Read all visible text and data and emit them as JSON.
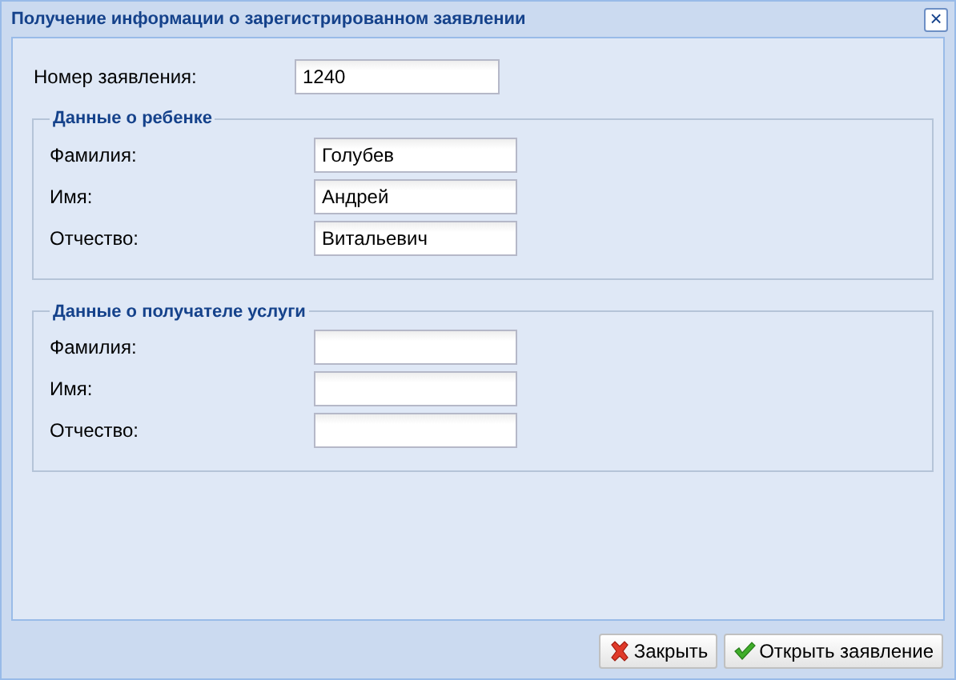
{
  "window": {
    "title": "Получение информации о зарегистрированном заявлении",
    "close": "×"
  },
  "number_field": {
    "label": "Номер заявления:",
    "value": "1240"
  },
  "sections": [
    {
      "title": "Данные о ребенке",
      "fields": [
        {
          "label": "Фамилия:",
          "value": "Голубев"
        },
        {
          "label": "Имя:",
          "value": "Андрей"
        },
        {
          "label": "Отчество:",
          "value": "Витальевич"
        }
      ]
    },
    {
      "title": "Данные о получателе услуги",
      "fields": [
        {
          "label": "Фамилия:"
        },
        {
          "label": "Имя:"
        },
        {
          "label": "Отчество:"
        }
      ]
    }
  ],
  "buttons": [
    {
      "label": "Закрыть",
      "kind": "close"
    },
    {
      "label": "Открыть заявление",
      "kind": "confirm"
    }
  ]
}
